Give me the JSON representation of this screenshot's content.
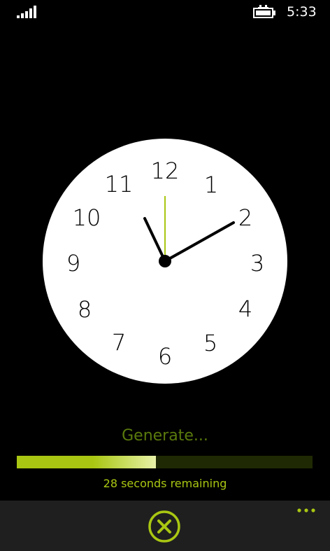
{
  "status_bar": {
    "time": "5:33",
    "signal_icon": "signal-bars-icon",
    "battery_icon": "battery-charging-icon"
  },
  "clock": {
    "numerals": [
      "12",
      "1",
      "2",
      "3",
      "4",
      "5",
      "6",
      "7",
      "8",
      "9",
      "10",
      "11"
    ],
    "hour_hand_icon": "hour-hand",
    "minute_hand_icon": "minute-hand",
    "second_hand_icon": "second-hand"
  },
  "progress": {
    "label": "Generate...",
    "fraction": 0.47,
    "remaining_text": "28 seconds remaining"
  },
  "app_bar": {
    "cancel_icon": "cancel-circle-icon",
    "more_icon": "more-dots-icon"
  },
  "colors": {
    "background": "#000000",
    "accent": "#a9c712",
    "accent_dim": "#5a7a0c",
    "track": "#1f2a04",
    "clock_face": "#ffffff",
    "app_bar": "#1f1f1f"
  }
}
